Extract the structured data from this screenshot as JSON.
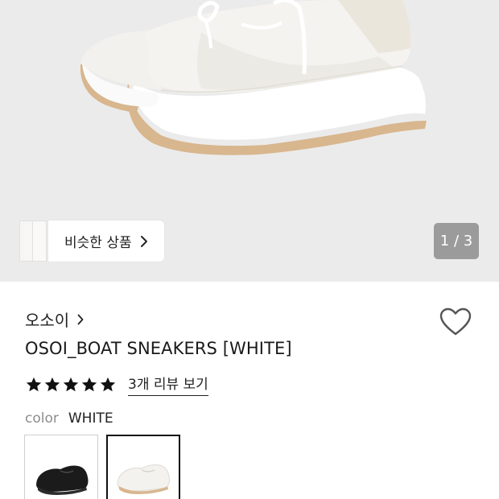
{
  "hero": {
    "colors": {
      "background": "#ebebeb",
      "shoe_upper": "#f4f2ee",
      "shoe_sole": "#ffffff",
      "outsole": "#d6b48c"
    }
  },
  "similar_products": {
    "label": "비슷한 상품",
    "icon": "chevron-right-icon"
  },
  "image_counter": {
    "text": "1 / 3"
  },
  "product": {
    "brand": "오소이",
    "name": "OSOI_BOAT SNEAKERS [WHITE]",
    "rating_stars": 5,
    "review_link": "3개 리뷰 보기",
    "color_label": "color",
    "color_value": "WHITE",
    "variants": [
      {
        "name": "black",
        "selected": false
      },
      {
        "name": "white",
        "selected": true
      }
    ]
  }
}
